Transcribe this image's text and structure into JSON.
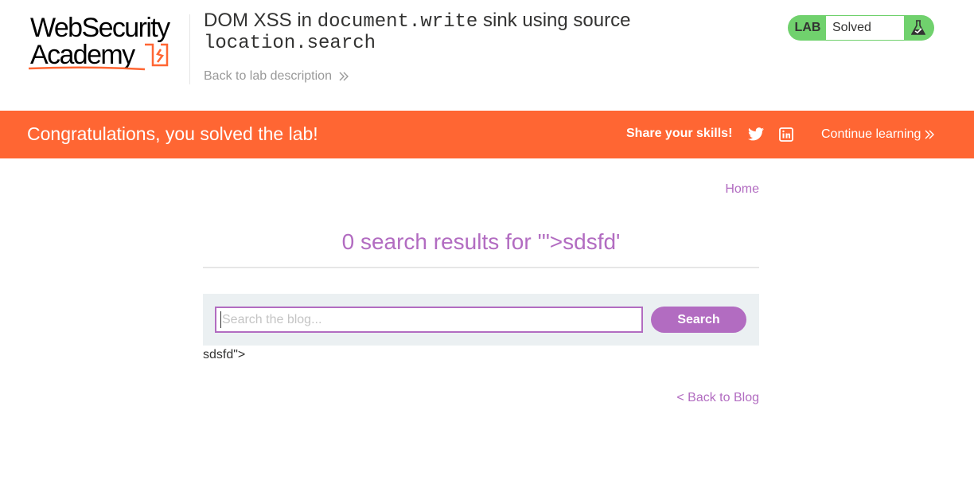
{
  "brand": {
    "logo_line1": "WebSecurity",
    "logo_line2": "Academy"
  },
  "lab": {
    "title_prefix": "DOM XSS in ",
    "title_code1": "document.write",
    "title_middle": " sink using source",
    "title_code2": "location.search",
    "back_to_description": "Back to lab description",
    "status_label": "LAB",
    "status_value": "Solved"
  },
  "banner": {
    "message": "Congratulations, you solved the lab!",
    "share_label": "Share your skills!",
    "continue_label": "Continue learning"
  },
  "main": {
    "home_link": "Home",
    "results_title": "0 search results for '\">sdsfd'",
    "search_placeholder": "Search the blog...",
    "search_button": "Search",
    "injected_text": "sdsfd\">",
    "back_to_blog": "< Back to Blog"
  },
  "colors": {
    "accent_orange": "#ff6633",
    "accent_purple": "#b26cc1",
    "status_green": "#70d16d"
  },
  "icons": {
    "twitter": "twitter-icon",
    "linkedin": "linkedin-icon",
    "flask": "flask-icon",
    "chevron": "double-chevron-right-icon"
  }
}
